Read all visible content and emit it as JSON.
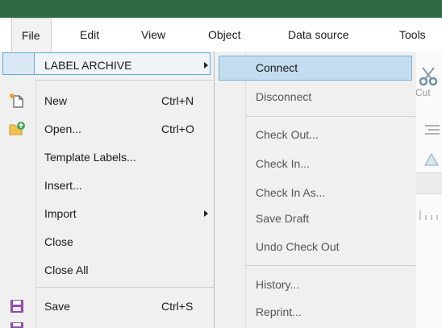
{
  "menubar": {
    "items": [
      "File",
      "Edit",
      "View",
      "Object",
      "Data source",
      "Tools"
    ]
  },
  "background": {
    "cut_label": "Cut"
  },
  "file_menu": {
    "label_archive": "LABEL ARCHIVE",
    "new": {
      "label": "New",
      "shortcut": "Ctrl+N"
    },
    "open": {
      "label": "Open...",
      "shortcut": "Ctrl+O"
    },
    "template_labels": "Template Labels...",
    "insert": "Insert...",
    "import": "Import",
    "close": "Close",
    "close_all": "Close All",
    "save": {
      "label": "Save",
      "shortcut": "Ctrl+S"
    }
  },
  "submenu": {
    "items": [
      "Connect",
      "Disconnect",
      "Check Out...",
      "Check In...",
      "Check In As...",
      "Save Draft",
      "Undo Check Out",
      "History...",
      "Reprint..."
    ]
  },
  "colors": {
    "titlebar": "#2f6a45",
    "highlight": "#c3dcef",
    "highlight_border": "#7ab4dd"
  }
}
